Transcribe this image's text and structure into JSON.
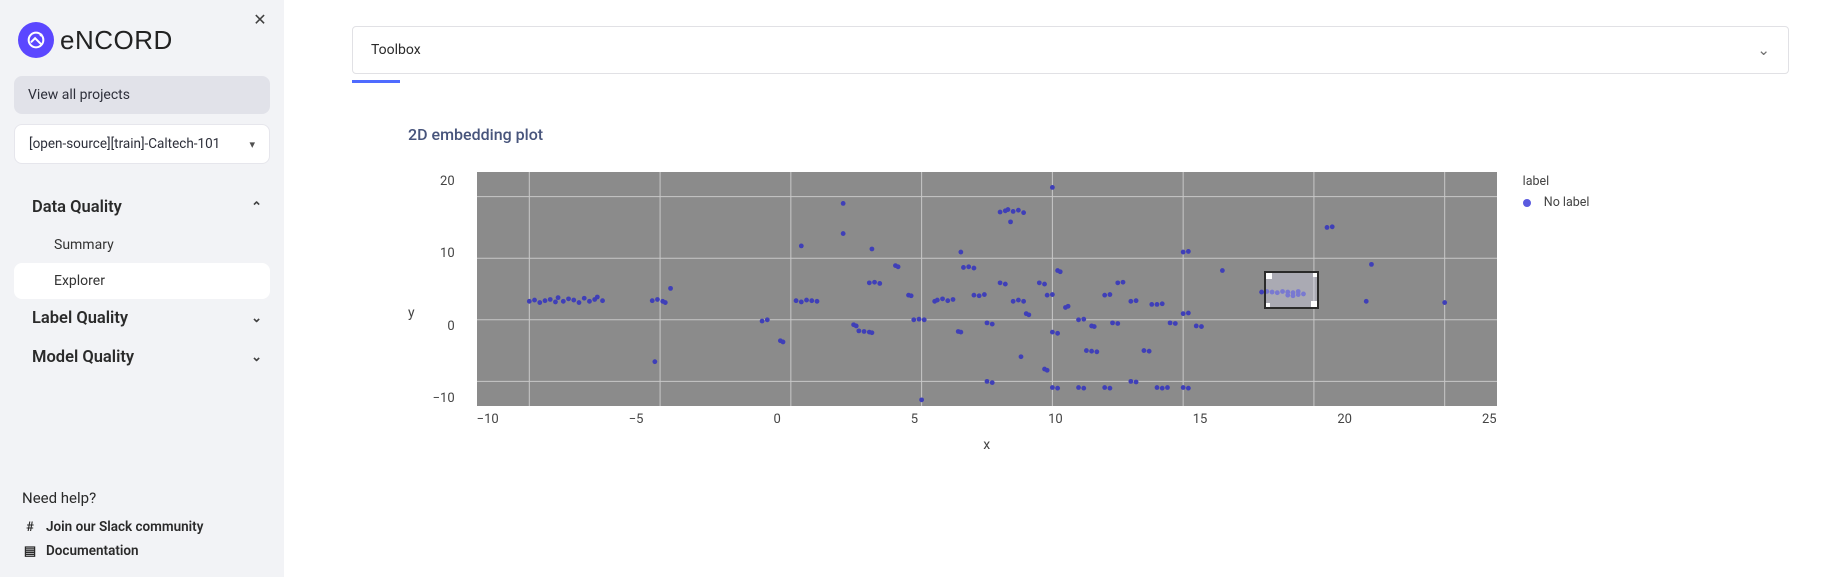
{
  "brand": {
    "name": "eNCORD"
  },
  "sidebar": {
    "view_all": "View all projects",
    "project": "[open-source][train]-Caltech-101",
    "sections": [
      {
        "label": "Data Quality",
        "expanded": true,
        "items": [
          {
            "label": "Summary",
            "active": false
          },
          {
            "label": "Explorer",
            "active": true
          }
        ]
      },
      {
        "label": "Label Quality",
        "expanded": false,
        "items": []
      },
      {
        "label": "Model Quality",
        "expanded": false,
        "items": []
      }
    ],
    "help": {
      "title": "Need help?",
      "links": [
        {
          "icon": "slack-icon",
          "label": "Join our Slack community"
        },
        {
          "icon": "doc-icon",
          "label": "Documentation"
        }
      ]
    }
  },
  "main": {
    "toolbox_label": "Toolbox",
    "chart_title": "2D embedding plot",
    "legend_title": "label",
    "legend_item": "No label",
    "selection_box": {
      "x_min": 18.1,
      "x_max": 20.2,
      "y_min": 1.8,
      "y_max": 8.0
    }
  },
  "chart_data": {
    "type": "scatter",
    "xlabel": "x",
    "ylabel": "y",
    "xlim": [
      -12,
      27
    ],
    "ylim": [
      -14,
      24
    ],
    "xticks": [
      -10,
      -5,
      0,
      5,
      10,
      15,
      20,
      25
    ],
    "yticks": [
      20,
      10,
      0,
      -10
    ],
    "series": [
      {
        "name": "No label",
        "color": "#3f3fb8",
        "points": [
          [
            -10.0,
            3.0
          ],
          [
            -9.8,
            3.2
          ],
          [
            -9.6,
            2.8
          ],
          [
            -9.4,
            3.1
          ],
          [
            -9.2,
            3.3
          ],
          [
            -9.0,
            2.9
          ],
          [
            -8.9,
            3.6
          ],
          [
            -8.7,
            3.0
          ],
          [
            -8.5,
            3.4
          ],
          [
            -8.3,
            3.2
          ],
          [
            -8.1,
            2.8
          ],
          [
            -7.9,
            3.5
          ],
          [
            -7.7,
            3.0
          ],
          [
            -7.5,
            3.3
          ],
          [
            -7.4,
            3.7
          ],
          [
            -7.2,
            3.1
          ],
          [
            -5.3,
            3.1
          ],
          [
            -5.1,
            3.3
          ],
          [
            -4.9,
            3.0
          ],
          [
            -4.8,
            2.8
          ],
          [
            -5.2,
            -6.8
          ],
          [
            -4.6,
            5.1
          ],
          [
            -1.1,
            -0.2
          ],
          [
            -0.9,
            0.0
          ],
          [
            -0.4,
            -3.4
          ],
          [
            -0.3,
            -3.6
          ],
          [
            0.2,
            3.1
          ],
          [
            0.4,
            2.9
          ],
          [
            0.6,
            3.2
          ],
          [
            0.8,
            3.1
          ],
          [
            1.0,
            3.0
          ],
          [
            0.4,
            12.0
          ],
          [
            2.0,
            14.0
          ],
          [
            2.0,
            18.9
          ],
          [
            2.4,
            -0.8
          ],
          [
            2.5,
            -1.0
          ],
          [
            2.6,
            -1.8
          ],
          [
            2.8,
            -1.9
          ],
          [
            3.0,
            -2.0
          ],
          [
            3.1,
            -2.1
          ],
          [
            3.1,
            11.5
          ],
          [
            3.0,
            6.0
          ],
          [
            3.2,
            6.1
          ],
          [
            3.4,
            5.9
          ],
          [
            4.0,
            8.8
          ],
          [
            4.1,
            8.6
          ],
          [
            4.5,
            4.0
          ],
          [
            4.6,
            3.9
          ],
          [
            4.7,
            0.0
          ],
          [
            4.9,
            0.1
          ],
          [
            5.1,
            0.0
          ],
          [
            5.0,
            -13.0
          ],
          [
            5.5,
            3.0
          ],
          [
            5.6,
            3.2
          ],
          [
            5.8,
            3.4
          ],
          [
            6.0,
            3.1
          ],
          [
            6.2,
            3.3
          ],
          [
            6.4,
            -1.9
          ],
          [
            6.5,
            -2.0
          ],
          [
            6.6,
            8.5
          ],
          [
            6.8,
            8.6
          ],
          [
            7.0,
            8.4
          ],
          [
            6.5,
            11.0
          ],
          [
            7.0,
            4.0
          ],
          [
            7.2,
            3.9
          ],
          [
            7.4,
            4.1
          ],
          [
            7.5,
            -0.5
          ],
          [
            7.7,
            -0.7
          ],
          [
            7.5,
            -10.0
          ],
          [
            7.7,
            -10.2
          ],
          [
            8.0,
            17.5
          ],
          [
            8.2,
            17.7
          ],
          [
            8.3,
            17.9
          ],
          [
            8.5,
            17.6
          ],
          [
            8.7,
            17.8
          ],
          [
            8.9,
            17.4
          ],
          [
            8.4,
            15.9
          ],
          [
            8.0,
            6.0
          ],
          [
            8.2,
            5.8
          ],
          [
            8.5,
            3.0
          ],
          [
            8.7,
            3.2
          ],
          [
            8.9,
            3.0
          ],
          [
            9.0,
            1.0
          ],
          [
            9.1,
            0.8
          ],
          [
            8.8,
            -6.0
          ],
          [
            9.5,
            6.0
          ],
          [
            9.7,
            5.8
          ],
          [
            9.8,
            4.0
          ],
          [
            10.0,
            4.1
          ],
          [
            10.0,
            21.5
          ],
          [
            10.2,
            8.0
          ],
          [
            10.3,
            7.8
          ],
          [
            10.5,
            2.0
          ],
          [
            10.6,
            2.2
          ],
          [
            10.0,
            -2.0
          ],
          [
            10.2,
            -2.2
          ],
          [
            9.7,
            -8.0
          ],
          [
            9.8,
            -8.2
          ],
          [
            10.0,
            -11.0
          ],
          [
            10.2,
            -11.1
          ],
          [
            11.0,
            0.0
          ],
          [
            11.2,
            0.1
          ],
          [
            11.5,
            -1.0
          ],
          [
            11.6,
            -1.1
          ],
          [
            11.3,
            -5.0
          ],
          [
            11.5,
            -5.1
          ],
          [
            11.7,
            -5.2
          ],
          [
            11.0,
            -11.0
          ],
          [
            11.2,
            -11.1
          ],
          [
            12.0,
            4.0
          ],
          [
            12.2,
            4.1
          ],
          [
            12.5,
            6.0
          ],
          [
            12.7,
            6.1
          ],
          [
            12.3,
            -0.5
          ],
          [
            12.5,
            -0.6
          ],
          [
            12.0,
            -11.0
          ],
          [
            12.2,
            -11.1
          ],
          [
            13.0,
            3.0
          ],
          [
            13.2,
            3.1
          ],
          [
            13.5,
            -5.0
          ],
          [
            13.7,
            -5.1
          ],
          [
            13.0,
            -10.0
          ],
          [
            13.2,
            -10.1
          ],
          [
            13.8,
            2.5
          ],
          [
            14.0,
            2.5
          ],
          [
            14.2,
            2.6
          ],
          [
            14.5,
            -0.5
          ],
          [
            14.7,
            -0.6
          ],
          [
            14.0,
            -11.0
          ],
          [
            14.2,
            -11.1
          ],
          [
            14.4,
            -11.0
          ],
          [
            15.0,
            1.0
          ],
          [
            15.2,
            1.1
          ],
          [
            15.5,
            -1.0
          ],
          [
            15.7,
            -1.1
          ],
          [
            15.0,
            11.0
          ],
          [
            15.2,
            11.1
          ],
          [
            15.0,
            -11.0
          ],
          [
            15.2,
            -11.1
          ],
          [
            16.5,
            8.0
          ],
          [
            18.0,
            4.5
          ],
          [
            18.2,
            4.6
          ],
          [
            18.4,
            4.5
          ],
          [
            18.6,
            4.4
          ],
          [
            18.8,
            4.6
          ],
          [
            19.0,
            4.5
          ],
          [
            19.2,
            4.4
          ],
          [
            19.4,
            4.6
          ],
          [
            19.0,
            4.0
          ],
          [
            19.2,
            3.9
          ],
          [
            19.4,
            4.1
          ],
          [
            19.6,
            4.2
          ],
          [
            20.5,
            15.0
          ],
          [
            20.7,
            15.1
          ],
          [
            22.0,
            3.0
          ],
          [
            22.2,
            9.0
          ],
          [
            25.0,
            2.8
          ]
        ]
      }
    ]
  }
}
